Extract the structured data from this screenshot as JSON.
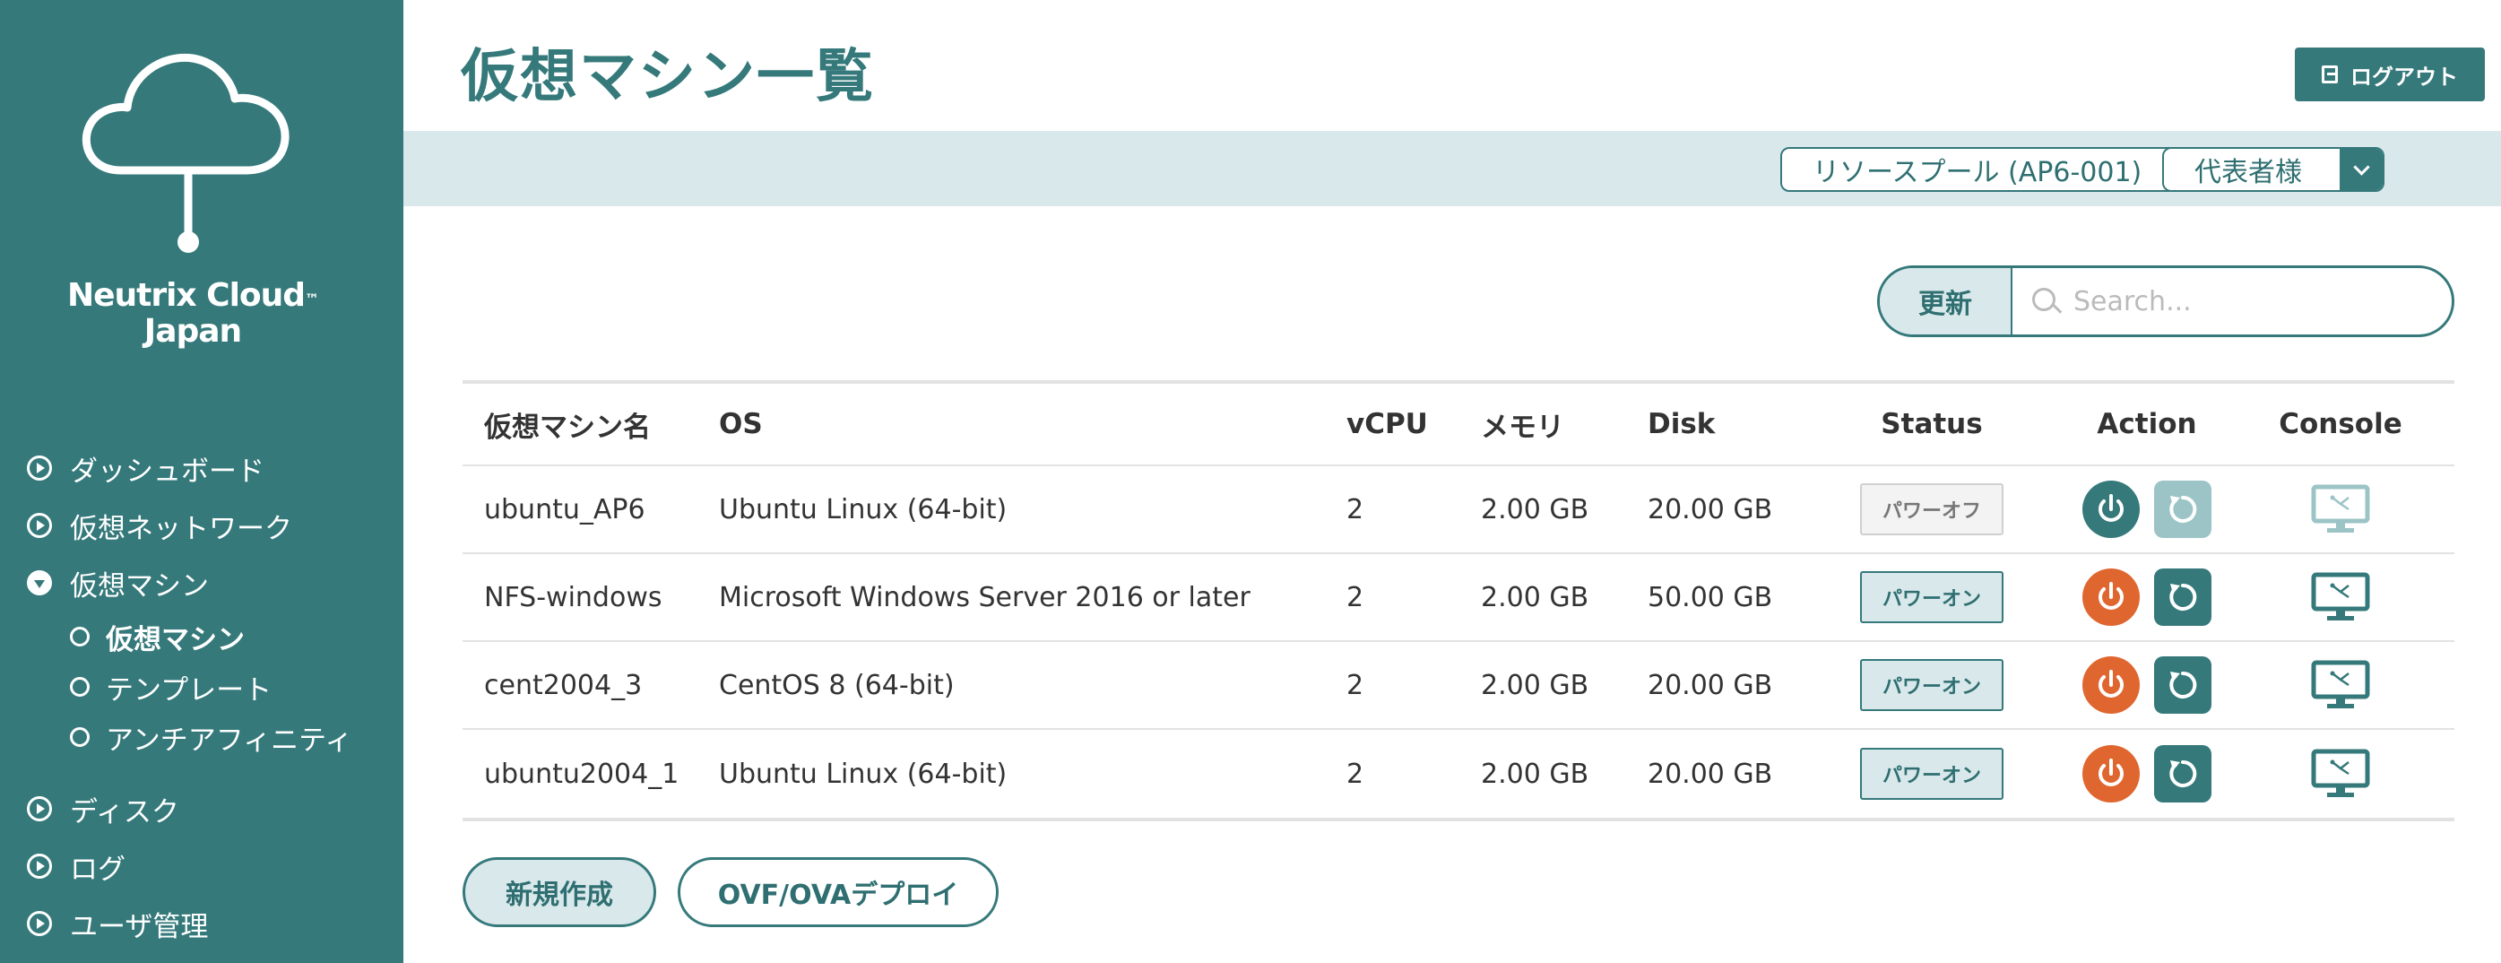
{
  "brand": {
    "line1": "Neutrix Cloud",
    "tm": "™",
    "line2": "Japan"
  },
  "sidebar": {
    "items": [
      {
        "label": "ダッシュボード"
      },
      {
        "label": "仮想ネットワーク"
      },
      {
        "label": "仮想マシン"
      },
      {
        "label": "ディスク"
      },
      {
        "label": "ログ"
      },
      {
        "label": "ユーザ管理"
      }
    ],
    "sub_items": [
      {
        "label": "仮想マシン"
      },
      {
        "label": "テンプレート"
      },
      {
        "label": "アンチアフィニティ"
      }
    ]
  },
  "header": {
    "title": "仮想マシン一覧",
    "logout_label": "ログアウト"
  },
  "filters": {
    "resource_pool": "リソースプール (AP6-001)",
    "user": "代表者様"
  },
  "toolbar": {
    "refresh_label": "更新",
    "search_placeholder": "Search..."
  },
  "table": {
    "headers": {
      "name": "仮想マシン名",
      "os": "OS",
      "vcpu": "vCPU",
      "memory": "メモリ",
      "disk": "Disk",
      "status": "Status",
      "action": "Action",
      "console": "Console"
    },
    "rows": [
      {
        "name": "ubuntu_AP6",
        "os": "Ubuntu Linux (64-bit)",
        "vcpu": "2",
        "memory": "2.00 GB",
        "disk": "20.00 GB",
        "status": "パワーオフ"
      },
      {
        "name": "NFS-windows",
        "os": "Microsoft Windows Server 2016 or later",
        "vcpu": "2",
        "memory": "2.00 GB",
        "disk": "50.00 GB",
        "status": "パワーオン"
      },
      {
        "name": "cent2004_3",
        "os": "CentOS 8 (64-bit)",
        "vcpu": "2",
        "memory": "2.00 GB",
        "disk": "20.00 GB",
        "status": "パワーオン"
      },
      {
        "name": "ubuntu2004_1",
        "os": "Ubuntu Linux (64-bit)",
        "vcpu": "2",
        "memory": "2.00 GB",
        "disk": "20.00 GB",
        "status": "パワーオン"
      }
    ]
  },
  "actions": {
    "new_label": "新規作成",
    "ovf_label": "OVF/OVAデプロイ"
  },
  "colors": {
    "primary": "#35797b",
    "power_on": "#e0662f",
    "disabled": "#9cc4c6",
    "band": "#d9e8eb"
  }
}
